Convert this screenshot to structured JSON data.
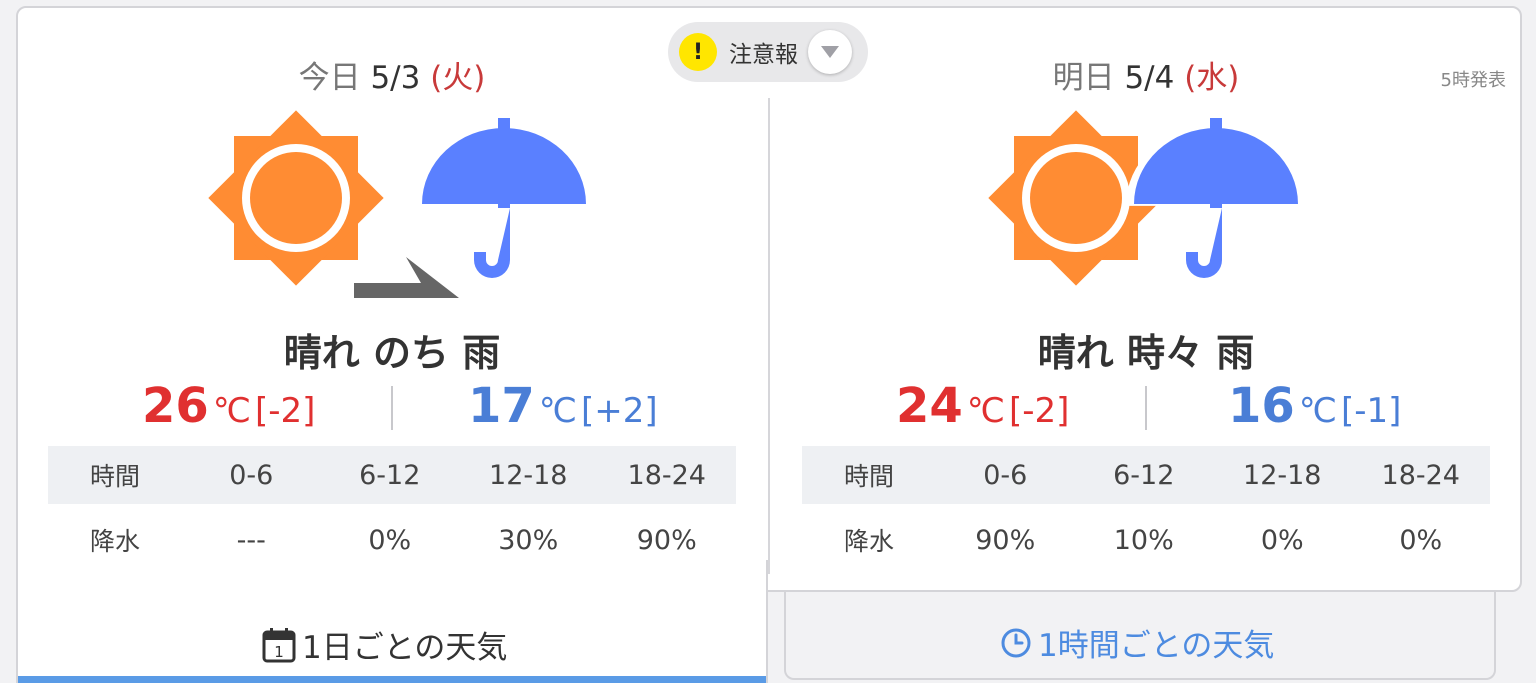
{
  "alert": {
    "icon": "exclamation-icon",
    "label": "注意報"
  },
  "announce": "5時発表",
  "today": {
    "label": "今日",
    "date": "5/3",
    "dow": "(火)",
    "icons": [
      "sun-icon",
      "arrow-later-icon",
      "umbrella-icon"
    ],
    "condition": "晴れ のち 雨",
    "high": {
      "value": "26",
      "unit": "℃",
      "diff": "[-2]"
    },
    "low": {
      "value": "17",
      "unit": "℃",
      "diff": "[+2]"
    },
    "precip": {
      "header_label": "時間",
      "row_label": "降水",
      "slots": [
        "0-6",
        "6-12",
        "12-18",
        "18-24"
      ],
      "values": [
        "---",
        "0%",
        "30%",
        "90%"
      ]
    }
  },
  "tomorrow": {
    "label": "明日",
    "date": "5/4",
    "dow": "(水)",
    "icons": [
      "sun-icon",
      "umbrella-icon"
    ],
    "condition": "晴れ 時々 雨",
    "high": {
      "value": "24",
      "unit": "℃",
      "diff": "[-2]"
    },
    "low": {
      "value": "16",
      "unit": "℃",
      "diff": "[-1]"
    },
    "precip": {
      "header_label": "時間",
      "row_label": "降水",
      "slots": [
        "0-6",
        "6-12",
        "12-18",
        "18-24"
      ],
      "values": [
        "90%",
        "10%",
        "0%",
        "0%"
      ]
    }
  },
  "tabs": [
    {
      "label": "1日ごとの天気",
      "icon": "calendar-icon",
      "icon_text": "1",
      "active": true
    },
    {
      "label": "1時間ごとの天気",
      "icon": "clock-icon",
      "active": false
    }
  ],
  "colors": {
    "high_temp": "#e03030",
    "low_temp": "#4a7ed6",
    "sun": "#ff8c33",
    "umbrella": "#5a80ff",
    "active_tab_bar": "#5a9be6",
    "alert_yellow": "#ffe600"
  }
}
